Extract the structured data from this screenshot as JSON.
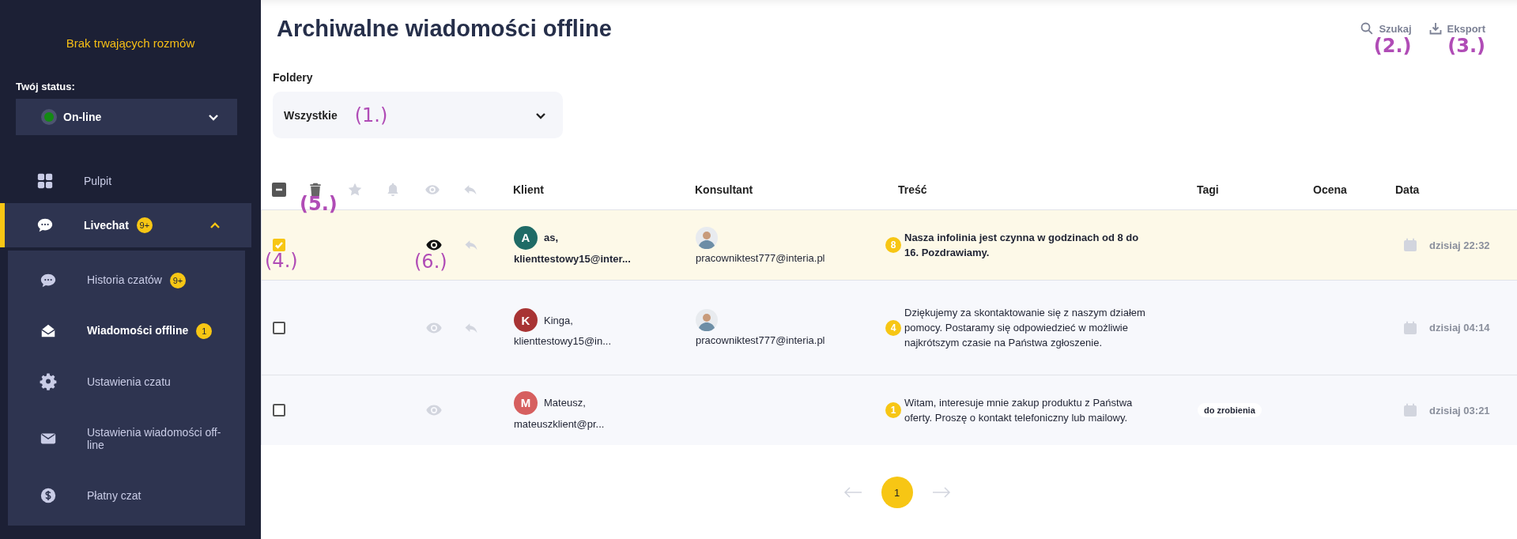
{
  "sidebar": {
    "status_banner": "Brak trwających rozmów",
    "status_label": "Twój status:",
    "status": {
      "value": "On-line",
      "color": "#138a13"
    },
    "nav": [
      {
        "kind": "dashboard",
        "label": "Pulpit",
        "selected": false
      },
      {
        "kind": "chat",
        "label": "Livechat",
        "badge": "9+",
        "selected": true,
        "expanded": true,
        "children": [
          {
            "kind": "chat",
            "label": "Historia czatów",
            "badge": "9+",
            "selected": false
          },
          {
            "kind": "mail-open",
            "label": "Wiadomości offline",
            "badge": "1",
            "selected": true
          },
          {
            "kind": "gear",
            "label": "Ustawienia czatu",
            "selected": false
          },
          {
            "kind": "mail",
            "label": "Ustawienia wiadomości off-line",
            "selected": false
          },
          {
            "kind": "money",
            "label": "Płatny czat",
            "selected": false
          }
        ]
      }
    ]
  },
  "page": {
    "title": "Archiwalne wiadomości offline",
    "actions": [
      {
        "kind": "search",
        "label": "Szukaj",
        "annotation": "(2.)"
      },
      {
        "kind": "export",
        "label": "Eksport",
        "annotation": "(3.)"
      }
    ]
  },
  "folders": {
    "label": "Foldery",
    "value": "Wszystkie",
    "annotation": "(1.)"
  },
  "table": {
    "indeterminate": true,
    "toolbar": [
      {
        "kind": "delete",
        "disabled": false,
        "annotation": "(5.)"
      },
      {
        "kind": "star",
        "disabled": true
      },
      {
        "kind": "bell",
        "disabled": true
      },
      {
        "kind": "view",
        "disabled": true
      },
      {
        "kind": "reply",
        "disabled": true
      }
    ],
    "columns": [
      "Klient",
      "Konsultant",
      "Treść",
      "Tagi",
      "Ocena",
      "Data"
    ],
    "rows": [
      {
        "selected": true,
        "unread": true,
        "eye_active": true,
        "can_reply": true,
        "checkbox_annotation": "(4.)",
        "view_annotation": "(6.)",
        "client": {
          "initial": "A",
          "color": "#1f6b66",
          "name": "as,",
          "email": "klienttestowy15@inter..."
        },
        "consultant": "pracowniktest777@interia.pl",
        "count": "8",
        "message": "Nasza infolinia jest czynna w godzinach od 8 do 16. Pozdrawiamy.",
        "tags": [],
        "date": "dzisiaj 22:32"
      },
      {
        "selected": false,
        "unread": false,
        "eye_active": false,
        "can_reply": true,
        "client": {
          "initial": "K",
          "color": "#a83434",
          "name": "Kinga,",
          "email": "klienttestowy15@in..."
        },
        "consultant": "pracowniktest777@interia.pl",
        "count": "4",
        "message": "Dziękujemy za skontaktowanie się z naszym działem pomocy. Postaramy się odpowiedzieć w możliwie najkrótszym czasie na Państwa zgłoszenie.",
        "tags": [],
        "date": "dzisiaj 04:14"
      },
      {
        "selected": false,
        "unread": false,
        "eye_active": false,
        "can_reply": false,
        "client": {
          "initial": "M",
          "color": "#d65f5f",
          "name": "Mateusz,",
          "email": "mateuszklient@pr..."
        },
        "count": "1",
        "message": "Witam, interesuje mnie zakup produktu z Państwa oferty. Proszę o kontakt telefoniczny lub mailowy.",
        "tags": [
          "do zrobienia"
        ],
        "date": "dzisiaj 03:21"
      }
    ]
  },
  "pagination": {
    "pages": [
      {
        "label": "1",
        "selected": true
      }
    ]
  }
}
